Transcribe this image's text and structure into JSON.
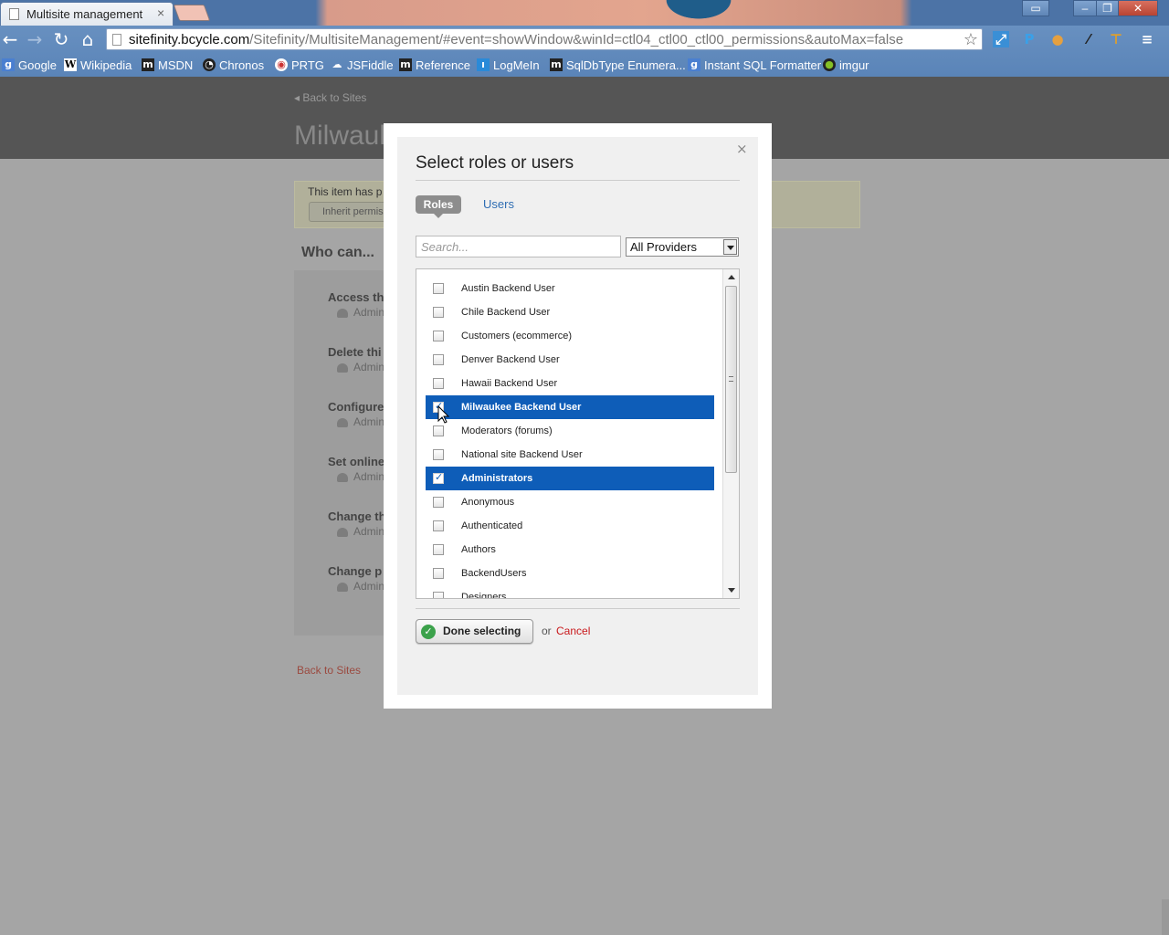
{
  "browser": {
    "tab_title": "Multisite management",
    "tab_close": "×",
    "url_host": "sitefinity.bcycle.com",
    "url_path": "/Sitefinity/MultisiteManagement/#event=showWindow&winId=ctl04_ctl00_ctl00_permissions&autoMax=false",
    "bookmarks": [
      {
        "label": "Google",
        "icon": "google-icon"
      },
      {
        "label": "Wikipedia",
        "icon": "wikipedia-icon"
      },
      {
        "label": "MSDN",
        "icon": "msdn-icon"
      },
      {
        "label": "Chronos",
        "icon": "chronos-icon"
      },
      {
        "label": "PRTG",
        "icon": "prtg-icon"
      },
      {
        "label": "JSFiddle",
        "icon": "jsfiddle-icon"
      },
      {
        "label": "Reference",
        "icon": "reference-icon"
      },
      {
        "label": "LogMeIn",
        "icon": "logmein-icon"
      },
      {
        "label": "SqlDbType Enumera...",
        "icon": "sqldbtype-icon"
      },
      {
        "label": "Instant SQL Formatter",
        "icon": "google-icon"
      },
      {
        "label": "imgur",
        "icon": "imgur-icon"
      }
    ]
  },
  "page": {
    "back_link": "Back to Sites",
    "site_title": "Milwauk",
    "notice_text": "This item has p",
    "inherit_button": "Inherit permiss",
    "who_can": "Who can...",
    "permissions": [
      {
        "name": "Access the",
        "who": "Admini"
      },
      {
        "name": "Delete thi",
        "who": "Admini"
      },
      {
        "name": "Configure",
        "who": "Admini"
      },
      {
        "name": "Set online",
        "who": "Admini"
      },
      {
        "name": "Change th",
        "who": "Admini"
      },
      {
        "name": "Change p",
        "who": "Admini"
      }
    ],
    "back_bottom": "Back to Sites"
  },
  "modal": {
    "title": "Select roles or users",
    "close": "×",
    "tabs": {
      "roles": "Roles",
      "users": "Users",
      "active": "roles"
    },
    "search_placeholder": "Search...",
    "provider": "All Providers",
    "items": [
      {
        "label": "Austin Backend User",
        "checked": false,
        "highlighted": false
      },
      {
        "label": "Chile Backend User",
        "checked": false,
        "highlighted": false
      },
      {
        "label": "Customers (ecommerce)",
        "checked": false,
        "highlighted": false
      },
      {
        "label": "Denver Backend User",
        "checked": false,
        "highlighted": false
      },
      {
        "label": "Hawaii Backend User",
        "checked": false,
        "highlighted": false
      },
      {
        "label": "Milwaukee Backend User",
        "checked": true,
        "highlighted": true
      },
      {
        "label": "Moderators (forums)",
        "checked": false,
        "highlighted": false
      },
      {
        "label": "National site Backend User",
        "checked": false,
        "highlighted": false
      },
      {
        "label": "Administrators",
        "checked": true,
        "highlighted": true
      },
      {
        "label": "Anonymous",
        "checked": false,
        "highlighted": false
      },
      {
        "label": "Authenticated",
        "checked": false,
        "highlighted": false
      },
      {
        "label": "Authors",
        "checked": false,
        "highlighted": false
      },
      {
        "label": "BackendUsers",
        "checked": false,
        "highlighted": false
      },
      {
        "label": "Designers",
        "checked": false,
        "highlighted": false
      }
    ],
    "done_button": "Done selecting",
    "or_text": "or",
    "cancel": "Cancel"
  },
  "colors": {
    "selection": "#0e5db8",
    "link": "#2f6db3",
    "cancel": "#c9191c",
    "ok_green": "#3ca24b"
  }
}
